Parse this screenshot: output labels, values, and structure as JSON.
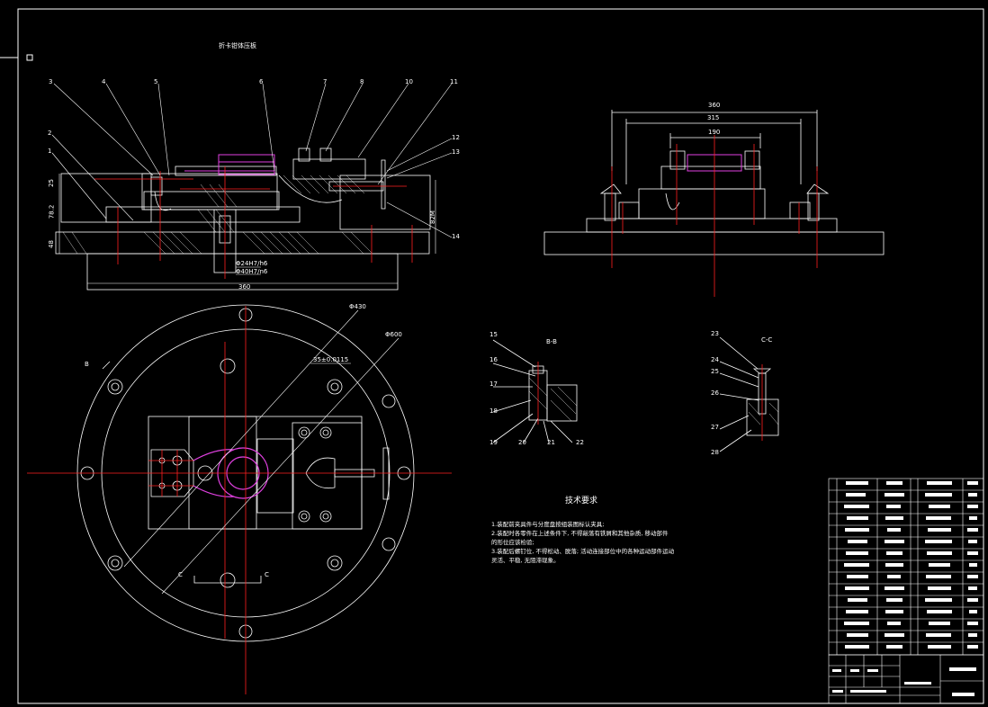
{
  "title_main_view": "折卡钳体压板",
  "section_bb": "B-B",
  "section_cc": "C-C",
  "tech_req": {
    "title": "技术要求",
    "lines": [
      "1.装配前夹具件与分度盘按组装图标认夹具;",
      "2.装配时各零件在上述条件下, 不得敲落有铁屑和其他杂质, 移动部件",
      "的形位应该检验;",
      "3.装配后螺钉位, 不得松动、脱落; 活动连接部位中的各种运动部件运动",
      "灵活、平稳, 无阻滞现象。"
    ]
  },
  "callouts_front": [
    "3",
    "4",
    "5",
    "6",
    "7",
    "8",
    "10",
    "11",
    "2",
    "1",
    "12",
    "13",
    "14"
  ],
  "callouts_bb": [
    "15",
    "16",
    "17",
    "18",
    "19",
    "20",
    "21",
    "22"
  ],
  "callouts_cc": [
    "23",
    "24",
    "25",
    "26",
    "27",
    "28"
  ],
  "dims": {
    "width_360_front": "360",
    "side_360": "360",
    "side_315": "315",
    "side_190": "190",
    "fit_1": "Φ24H7/h6",
    "fit_2": "Φ40H7/n6",
    "dia_430": "Φ430",
    "dia_600": "Φ600",
    "offset": "35±0.0115",
    "left_v1": "25",
    "left_v2": "78.2",
    "left_v3": "48",
    "right_v": "82M"
  },
  "view_markers": {
    "b": "B",
    "c_left": "C",
    "c_right": "C"
  }
}
